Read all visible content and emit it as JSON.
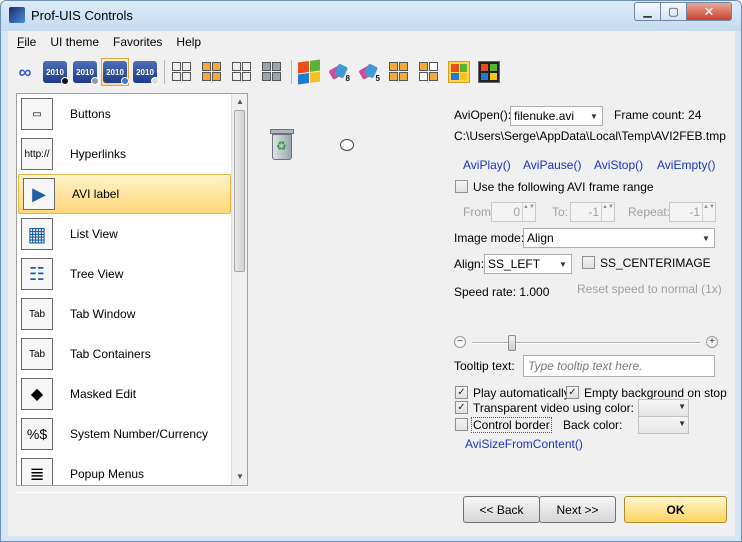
{
  "window": {
    "title": "Prof-UIS Controls",
    "min_glyph": "▁",
    "max_glyph": "▢",
    "close_glyph": "✕"
  },
  "menu": [
    {
      "label": "File"
    },
    {
      "label": "UI theme"
    },
    {
      "label": "Favorites"
    },
    {
      "label": "Help"
    }
  ],
  "toolbar": {
    "theme_label": "2010",
    "icons": [
      "infinity-icon",
      "office-2010-black-icon",
      "office-2010-silver-icon",
      "office-2010-blue-icon",
      "office-2010-white-icon",
      "office-2003-cube-icon",
      "office-xp-cube-icon",
      "office-2000-cube-icon",
      "studio-cube-icon",
      "windows-xp-icon",
      "visual-studio-2008-icon",
      "visual-studio-2005-icon",
      "orange-cube-icon",
      "mixed-cube-icon",
      "native-xp-icon",
      "windows-classic-icon"
    ]
  },
  "sidebar": {
    "items": [
      {
        "label": "Buttons",
        "icon": "buttons-icon",
        "glyph": "▭"
      },
      {
        "label": "Hyperlinks",
        "icon": "hyperlinks-icon",
        "glyph": "http://"
      },
      {
        "label": "AVI label",
        "icon": "avi-label-icon",
        "glyph": "▶"
      },
      {
        "label": "List View",
        "icon": "list-view-icon",
        "glyph": "▦"
      },
      {
        "label": "Tree View",
        "icon": "tree-view-icon",
        "glyph": "☷"
      },
      {
        "label": "Tab Window",
        "icon": "tab-window-icon",
        "glyph": "Tab"
      },
      {
        "label": "Tab Containers",
        "icon": "tab-containers-icon",
        "glyph": "Tab"
      },
      {
        "label": "Masked Edit",
        "icon": "masked-edit-icon",
        "glyph": "◆"
      },
      {
        "label": "System Number/Currency",
        "icon": "system-number-currency-icon",
        "glyph": "%$"
      },
      {
        "label": "Popup Menus",
        "icon": "popup-menus-icon",
        "glyph": "≣"
      }
    ],
    "selected": "AVI label"
  },
  "avi": {
    "open_label": "AviOpen():",
    "file_value": "filenuke.avi",
    "frame_count_label": "Frame count: 24",
    "path": "C:\\Users\\Serge\\AppData\\Local\\Temp\\AVI2FEB.tmp",
    "links": {
      "play": "AviPlay()",
      "pause": "AviPause()",
      "stop": "AviStop()",
      "empty": "AviEmpty()",
      "size_from_content": "AviSizeFromContent()"
    },
    "frame_range": {
      "checkbox_label": "Use the following AVI frame range",
      "checked": false,
      "from_label": "From:",
      "from_value": "0",
      "to_label": "To:",
      "to_value": "-1",
      "repeat_label": "Repeat:",
      "repeat_value": "-1"
    },
    "image_mode": {
      "label": "Image mode:",
      "value": "Align"
    },
    "align": {
      "label": "Align:",
      "value": "SS_LEFT"
    },
    "centerimage": {
      "label": "SS_CENTERIMAGE",
      "checked": false
    },
    "speed": {
      "label": "Speed rate: 1.000",
      "reset_label": "Reset speed to normal (1x)",
      "position": 0.16
    },
    "tooltip": {
      "label": "Tooltip text:",
      "placeholder": "Type tooltip text here."
    },
    "options": {
      "play_auto": {
        "label": "Play automatically",
        "checked": true
      },
      "empty_bg": {
        "label": "Empty background on stop",
        "checked": true
      },
      "transparent": {
        "label": "Transparent video using color:",
        "checked": true
      },
      "control_border": {
        "label": "Control border",
        "checked": false
      },
      "back_color_label": "Back color:"
    }
  },
  "buttons": {
    "back": "<< Back",
    "next": "Next >>",
    "ok": "OK"
  },
  "glyphs": {
    "check": "✓",
    "dropdown": "▼",
    "minus": "−",
    "plus": "+",
    "scroll_up": "▲",
    "scroll_down": "▼",
    "spin": "▲▼",
    "recycle": "♻"
  }
}
